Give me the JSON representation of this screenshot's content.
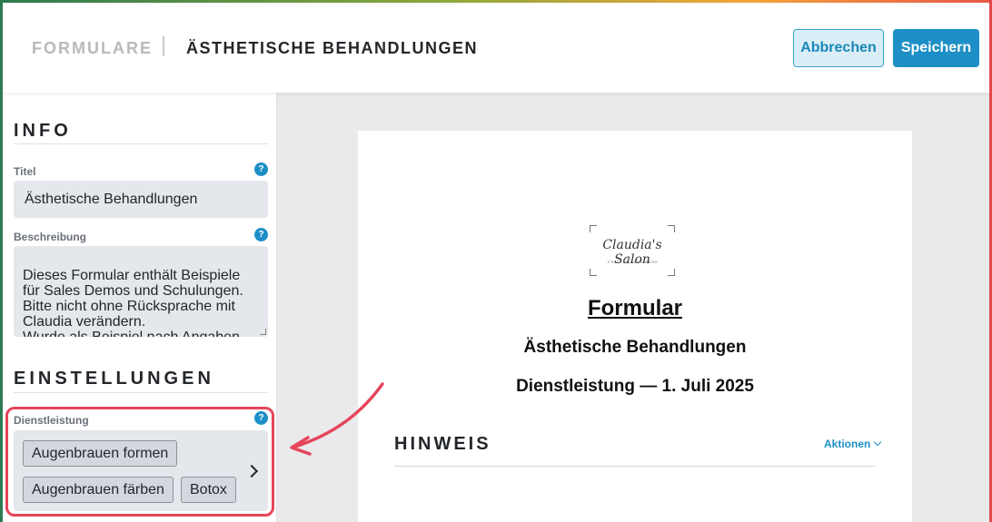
{
  "header": {
    "breadcrumb_parent": "FORMULARE",
    "breadcrumb_current": "ÄSTHETISCHE BEHANDLUNGEN",
    "cancel_label": "Abbrechen",
    "save_label": "Speichern"
  },
  "sidebar": {
    "info_title": "INFO",
    "title_label": "Titel",
    "title_value": "Ästhetische Behandlungen",
    "description_label": "Beschreibung",
    "description_value": "Dieses Formular enthält Beispiele\nfür Sales Demos und Schulungen.\nBitte nicht ohne Rücksprache mit\nClaudia verändern.\nWurde als Beispiel nach Angaben",
    "settings_title": "EINSTELLUNGEN",
    "service_label": "Dienstleistung",
    "service_tags": [
      "Augenbrauen formen",
      "Augenbrauen färben",
      "Botox"
    ],
    "help_glyph": "?"
  },
  "preview": {
    "logo_text": "Claudia's Salon",
    "logo_subtext": "FRISEURHANDWERK",
    "heading": "Formular",
    "subheading": "Ästhetische Behandlungen",
    "meta": "Dienstleistung — 1. Juli 2025",
    "section_title": "HINWEIS",
    "actions_label": "Aktionen"
  },
  "icons": {
    "help": "help-icon",
    "chevron_right": "chevron-right-icon",
    "chevron_down": "chevron-down-icon"
  },
  "colors": {
    "accent": "#1d8fc6",
    "highlight": "#e6455a",
    "input_bg": "#e4e7eb"
  }
}
